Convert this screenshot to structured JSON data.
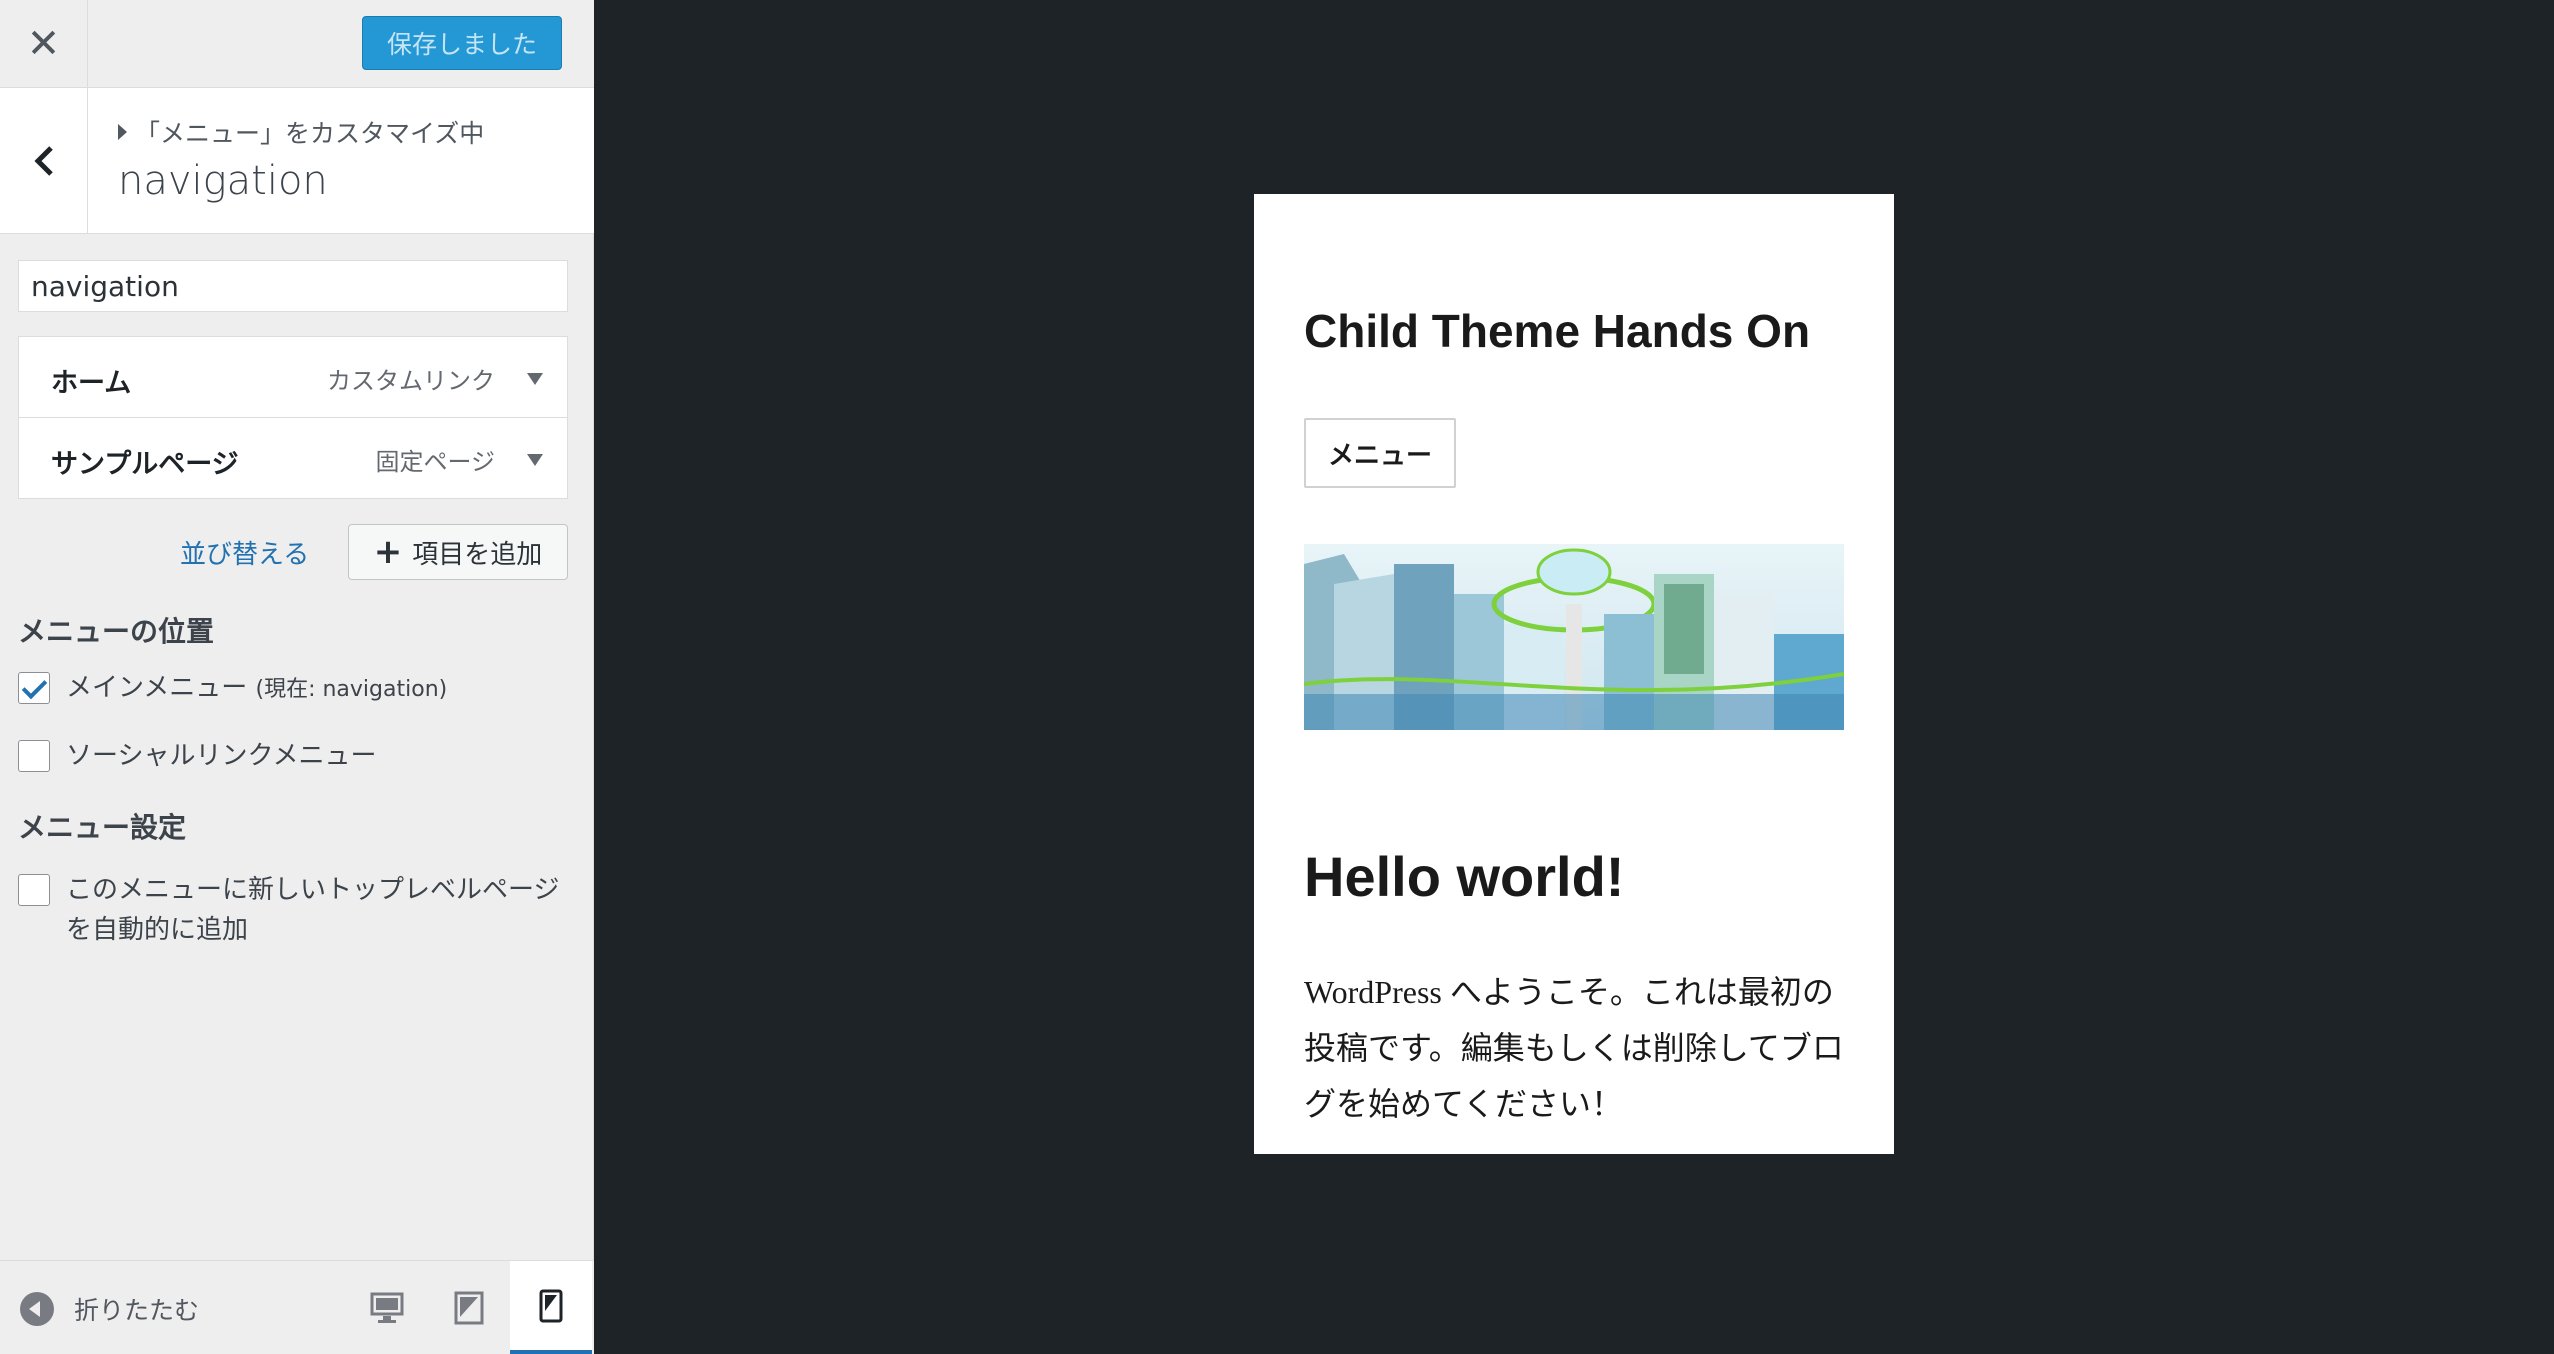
{
  "sidebar": {
    "close_icon": "close-icon",
    "save_label": "保存しました",
    "breadcrumb": "「メニュー」をカスタマイズ中",
    "section_title": "navigation",
    "menu_name_value": "navigation",
    "menu_items": [
      {
        "title": "ホーム",
        "type": "カスタムリンク"
      },
      {
        "title": "サンプルページ",
        "type": "固定ページ"
      }
    ],
    "reorder_label": "並び替える",
    "add_item_label": "項目を追加",
    "locations_heading": "メニューの位置",
    "locations": [
      {
        "label": "メインメニュー",
        "note": "(現在: navigation)",
        "checked": true
      },
      {
        "label": "ソーシャルリンクメニュー",
        "note": "",
        "checked": false
      }
    ],
    "settings_heading": "メニュー設定",
    "auto_add_line1": "このメニューに新しいトップレベルページ",
    "auto_add_line2": "を自動的に追加",
    "auto_add_checked": false,
    "footer": {
      "collapse_label": "折りたたむ",
      "devices": [
        "desktop",
        "tablet",
        "mobile"
      ],
      "active_device": "mobile"
    }
  },
  "preview": {
    "site_title": "Child Theme Hands On",
    "menu_button": "メニュー",
    "post_title": "Hello world!",
    "post_excerpt": "WordPress へようこそ。これは最初の投稿です。編集もしくは削除してブログを始めてください！"
  },
  "colors": {
    "primary": "#2271b1",
    "save_button": "#2398d5",
    "preview_background": "#1d2327",
    "sidebar_background": "#eeeeee"
  }
}
